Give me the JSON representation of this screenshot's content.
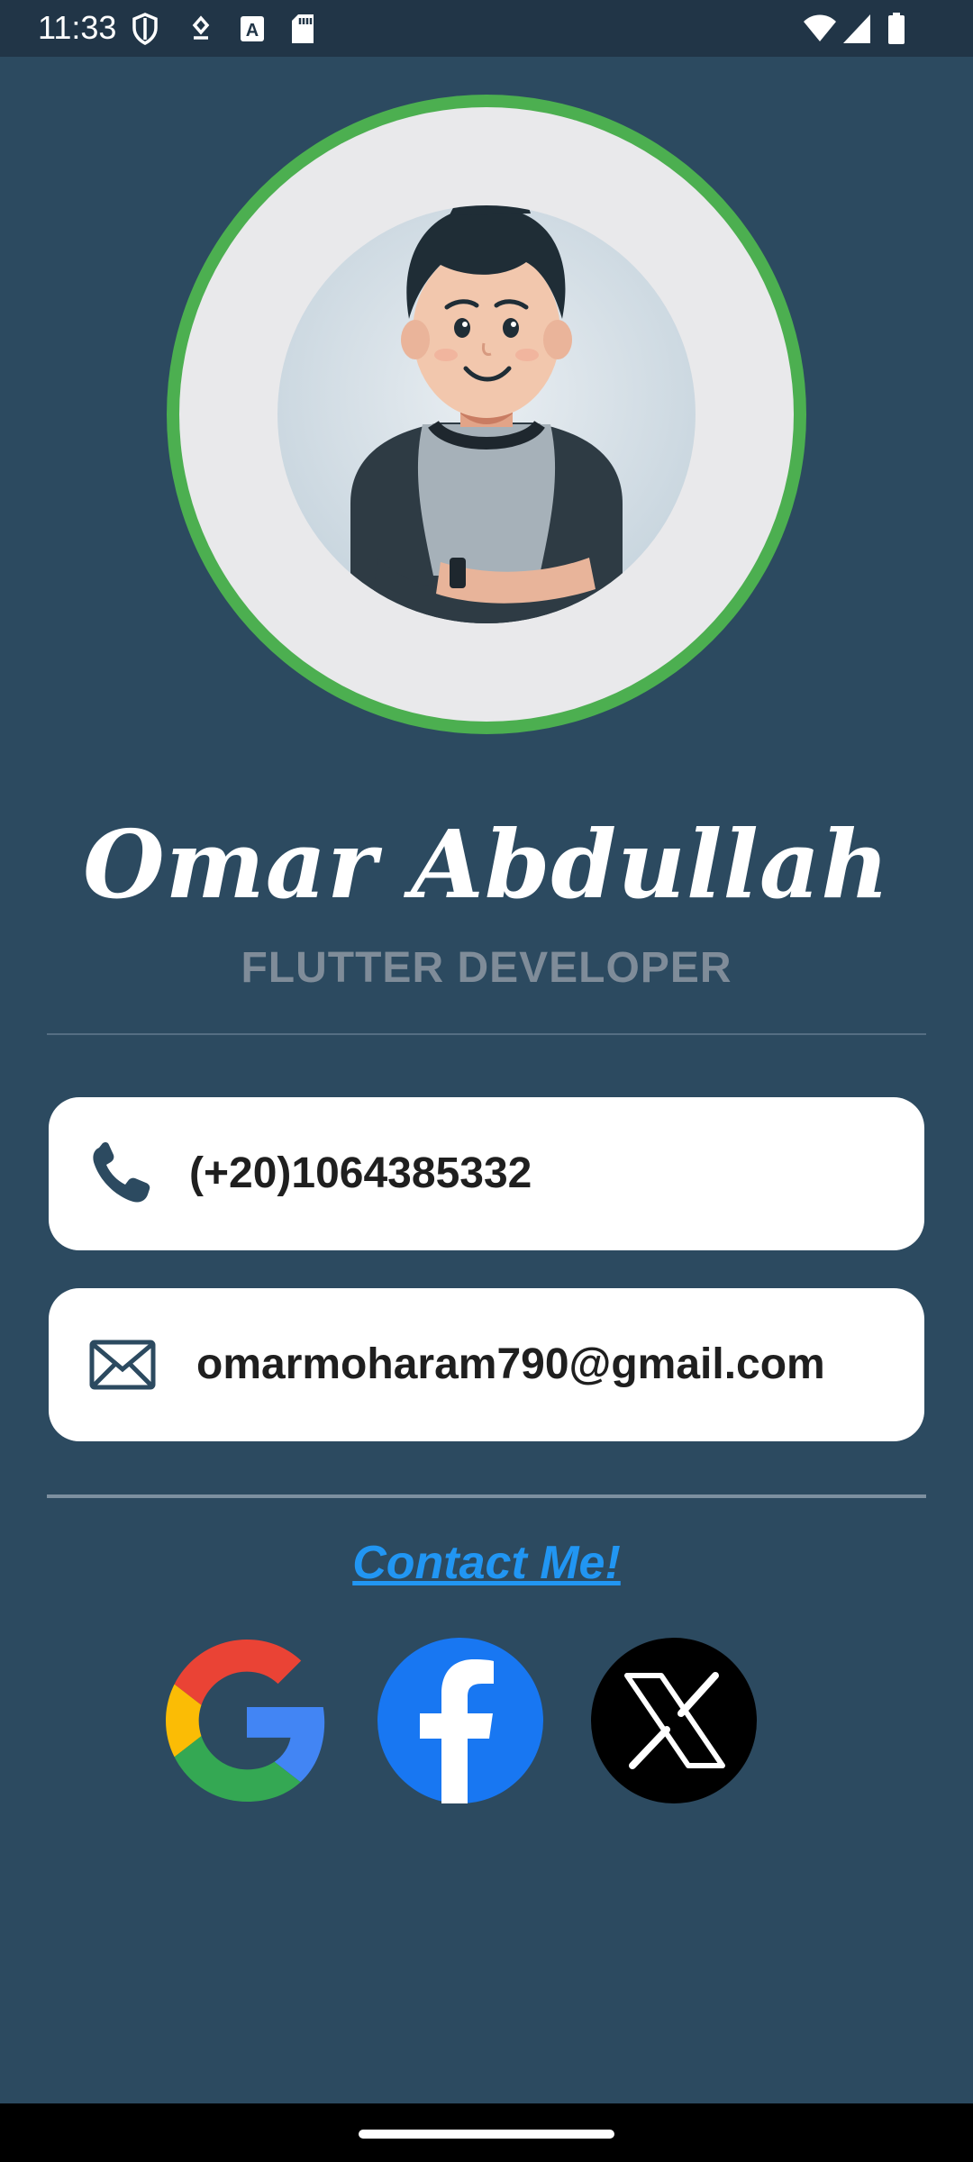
{
  "status_bar": {
    "time": "11:33",
    "left_icons": [
      "shield-icon",
      "download-icon",
      "keyboard-a-icon",
      "sd-card-icon"
    ],
    "right_icons": [
      "wifi-icon",
      "signal-icon",
      "battery-icon"
    ]
  },
  "profile": {
    "name": "Omar Abdullah",
    "role": "FLUTTER DEVELOPER",
    "avatar_icon": "cartoon-avatar",
    "ring_color": "#4caf50"
  },
  "contacts": {
    "phone": {
      "icon": "phone-icon",
      "value": "(+20)1064385332"
    },
    "email": {
      "icon": "envelope-icon",
      "value": "omarmoharam790@gmail.com"
    }
  },
  "contact_link": {
    "label": "Contact Me!",
    "color": "#2196f3"
  },
  "social": [
    {
      "name": "google",
      "icon": "google-icon"
    },
    {
      "name": "facebook",
      "icon": "facebook-icon",
      "color": "#1877f2"
    },
    {
      "name": "x",
      "icon": "x-icon",
      "color": "#000000"
    }
  ],
  "colors": {
    "background": "#2c4a60",
    "status_bar": "#213547",
    "card": "#ffffff"
  }
}
